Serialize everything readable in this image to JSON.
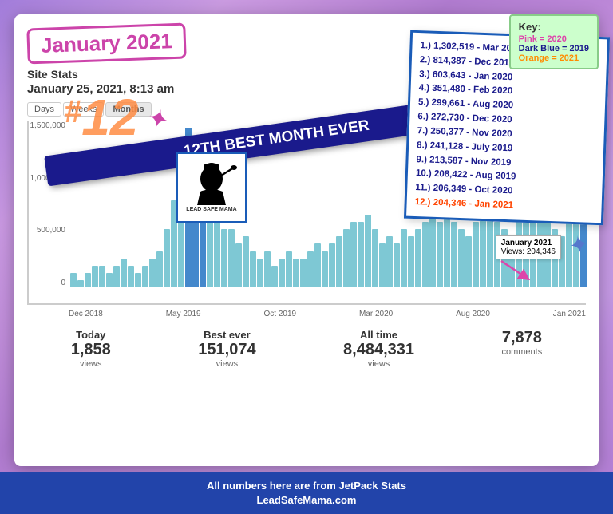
{
  "background": {
    "color": "#9b7fc7"
  },
  "header": {
    "title": "January 2021",
    "site_stats": "Site Stats",
    "date": "January 25, 2021, 8:13 am"
  },
  "tabs": [
    {
      "label": "Days",
      "active": false
    },
    {
      "label": "Weeks",
      "active": false
    },
    {
      "label": "Months",
      "active": true
    }
  ],
  "chart": {
    "y_axis": [
      "1,500,000",
      "1,000,000",
      "500,000",
      "0"
    ],
    "x_axis": [
      "Dec 2018",
      "May 2019",
      "Oct 2019",
      "Mar 2020",
      "Aug 2020",
      "Jan 2021"
    ],
    "bars": [
      2,
      3,
      4,
      3,
      2,
      3,
      4,
      5,
      8,
      12,
      18,
      22,
      15,
      10,
      8,
      6,
      5,
      4,
      3,
      4,
      5,
      6,
      7,
      8,
      9,
      10,
      8,
      6,
      5,
      6,
      7,
      8,
      9,
      10,
      11,
      9,
      8,
      7,
      9,
      11,
      13,
      10,
      8,
      7,
      6,
      5,
      6,
      7,
      8,
      9,
      10,
      11,
      12,
      13,
      14,
      13,
      12,
      10,
      9,
      8,
      7,
      6,
      5,
      6,
      7,
      8,
      9,
      10,
      11,
      12,
      13,
      14
    ]
  },
  "banner": {
    "text": "12th Best Month Ever"
  },
  "number_badge": "12",
  "rankings": {
    "items": [
      "1.)  1,302,519 - Mar 2019",
      "2.)     814,387 - Dec 2019",
      "3.)     603,643 - Jan 2020",
      "4.)     351,480 - Feb 2020",
      "5.)     299,661 - Aug 2020",
      "6.)     272,730 - Dec 2020",
      "7.)     250,377 - Nov 2020",
      "8.)     241,128 - July 2019",
      "9.)     213,587 - Nov 2019",
      "10.)   208,422 - Aug 2019",
      "11.)   206,349 - Oct 2020",
      "12.)   204,346 - Jan 2021"
    ]
  },
  "tooltip": {
    "title": "January 2021",
    "value": "Views: 204,346"
  },
  "stats": [
    {
      "label": "Today",
      "value": "1,858",
      "sublabel": "views"
    },
    {
      "label": "Best ever",
      "value": "151,074",
      "sublabel": "views"
    },
    {
      "label": "All time",
      "value": "8,484,331",
      "sublabel": "views"
    },
    {
      "label": "",
      "value": "7,878",
      "sublabel": "comments"
    }
  ],
  "key": {
    "title": "Key:",
    "items": [
      {
        "color": "pink",
        "label": "Pink = 2020"
      },
      {
        "color": "darkblue",
        "label": "Dark Blue = 2019"
      },
      {
        "color": "orange",
        "label": "Orange = 2021"
      }
    ]
  },
  "logo": {
    "text": "LEAD SAFE MAMA"
  },
  "bottom_bar": {
    "line1": "All numbers here are from JetPack Stats",
    "line2": "LeadSafeMama.com"
  },
  "starfish": [
    "★",
    "✦"
  ]
}
